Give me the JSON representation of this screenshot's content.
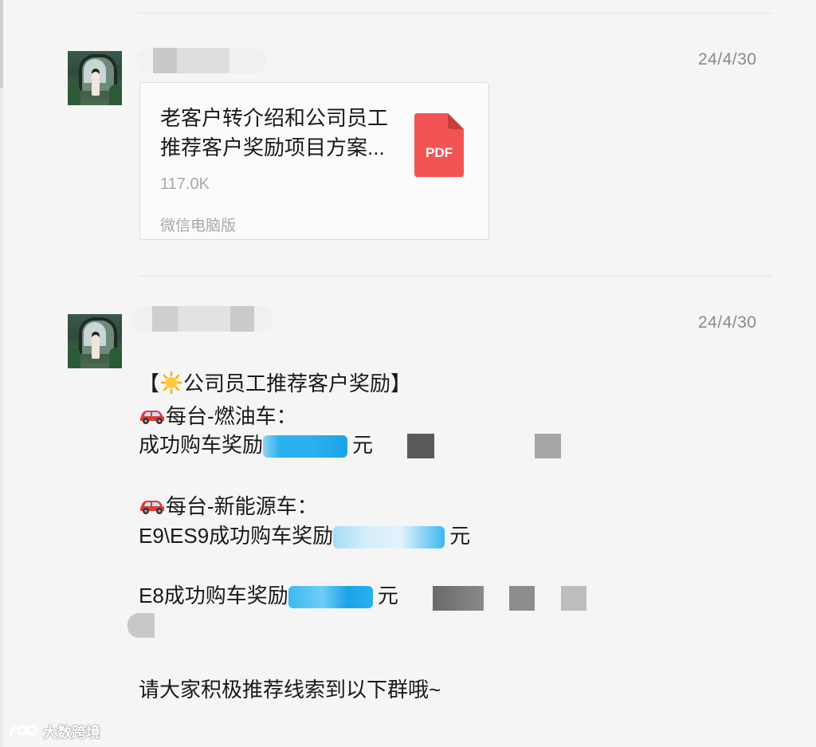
{
  "messages": [
    {
      "timestamp": "24/4/30",
      "file": {
        "title_line1": "老客户转介绍和公司员工",
        "title_line2": "推荐客户奖励项目方案...",
        "size": "117.0K",
        "source": "微信电脑版",
        "icon_label": "PDF",
        "icon": "pdf-file-icon"
      }
    },
    {
      "timestamp": "24/4/30",
      "heading_open": "【",
      "heading_text": "公司员工推荐客户奖励】",
      "heading_icon": "sun-emoji-icon",
      "fuel_title": "每台-燃油车：",
      "fuel_reward_prefix": "成功购车奖励",
      "fuel_reward_suffix": "元",
      "ev_title": "每台-新能源车：",
      "ev_e9_prefix": "E9\\ES9成功购车奖励",
      "ev_e9_suffix": "元",
      "ev_e8_prefix": "E8成功购车奖励",
      "ev_e8_suffix": "元",
      "closing": "请大家积极推荐线索到以下群哦~",
      "car_icon": "red-car-emoji-icon"
    }
  ],
  "watermark": {
    "text": "大数跨境",
    "icon": "watermark-logo-icon"
  },
  "colors": {
    "background": "#f5f5f5",
    "pdf_red": "#f25454",
    "redaction_blue": "#29b0ee",
    "timestamp_gray": "#8a8a8a"
  }
}
